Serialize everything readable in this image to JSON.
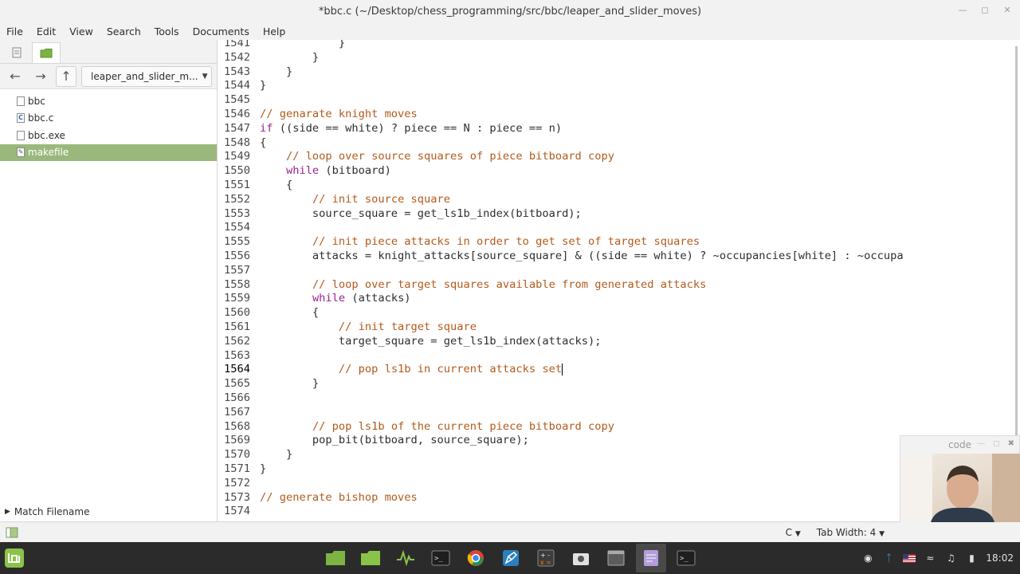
{
  "window": {
    "title": "*bbc.c (~/Desktop/chess_programming/src/bbc/leaper_and_slider_moves)"
  },
  "menu": [
    "File",
    "Edit",
    "View",
    "Search",
    "Tools",
    "Documents",
    "Help"
  ],
  "sidebar": {
    "folder": "leaper_and_slider_m...",
    "files": [
      {
        "name": "bbc",
        "icon": "file-icon"
      },
      {
        "name": "bbc.c",
        "icon": "c-source-icon"
      },
      {
        "name": "bbc.exe",
        "icon": "file-icon"
      },
      {
        "name": "makefile",
        "icon": "makefile-icon",
        "selected": true
      }
    ],
    "match_filename": "Match Filename"
  },
  "editor": {
    "lines": [
      {
        "n": "1541",
        "t": "            }"
      },
      {
        "n": "1542",
        "t": "        }"
      },
      {
        "n": "1543",
        "t": "    }"
      },
      {
        "n": "1544",
        "t": "}"
      },
      {
        "n": "1545",
        "t": ""
      },
      {
        "n": "1546",
        "t": "// genarate knight moves"
      },
      {
        "n": "1547",
        "t": "if ((side == white) ? piece == N : piece == n)"
      },
      {
        "n": "1548",
        "t": "{"
      },
      {
        "n": "1549",
        "t": "    // loop over source squares of piece bitboard copy"
      },
      {
        "n": "1550",
        "t": "    while (bitboard)"
      },
      {
        "n": "1551",
        "t": "    {"
      },
      {
        "n": "1552",
        "t": "        // init source square"
      },
      {
        "n": "1553",
        "t": "        source_square = get_ls1b_index(bitboard);"
      },
      {
        "n": "1554",
        "t": ""
      },
      {
        "n": "1555",
        "t": "        // init piece attacks in order to get set of target squares"
      },
      {
        "n": "1556",
        "t": "        attacks = knight_attacks[source_square] & ((side == white) ? ~occupancies[white] : ~occupa"
      },
      {
        "n": "1557",
        "t": ""
      },
      {
        "n": "1558",
        "t": "        // loop over target squares available from generated attacks"
      },
      {
        "n": "1559",
        "t": "        while (attacks)"
      },
      {
        "n": "1560",
        "t": "        {"
      },
      {
        "n": "1561",
        "t": "            // init target square"
      },
      {
        "n": "1562",
        "t": "            target_square = get_ls1b_index(attacks);"
      },
      {
        "n": "1563",
        "t": ""
      },
      {
        "n": "1564",
        "t": "            // pop ls1b in current attacks set"
      },
      {
        "n": "1565",
        "t": "        }"
      },
      {
        "n": "1566",
        "t": ""
      },
      {
        "n": "1567",
        "t": ""
      },
      {
        "n": "1568",
        "t": "        // pop ls1b of the current piece bitboard copy"
      },
      {
        "n": "1569",
        "t": "        pop_bit(bitboard, source_square);"
      },
      {
        "n": "1570",
        "t": "    }"
      },
      {
        "n": "1571",
        "t": "}"
      },
      {
        "n": "1572",
        "t": ""
      },
      {
        "n": "1573",
        "t": "// generate bishop moves"
      },
      {
        "n": "1574",
        "t": ""
      }
    ],
    "current_line": "1564"
  },
  "status": {
    "language": "C",
    "tab_width": "Tab Width: 4"
  },
  "overlay": {
    "title": "code"
  },
  "taskbar": {
    "clock": "18:02"
  },
  "colors": {
    "keyword": "#9b2393",
    "comment": "#b35a1b",
    "selection": "#9ab87c",
    "taskbar": "#2b2b2b"
  }
}
